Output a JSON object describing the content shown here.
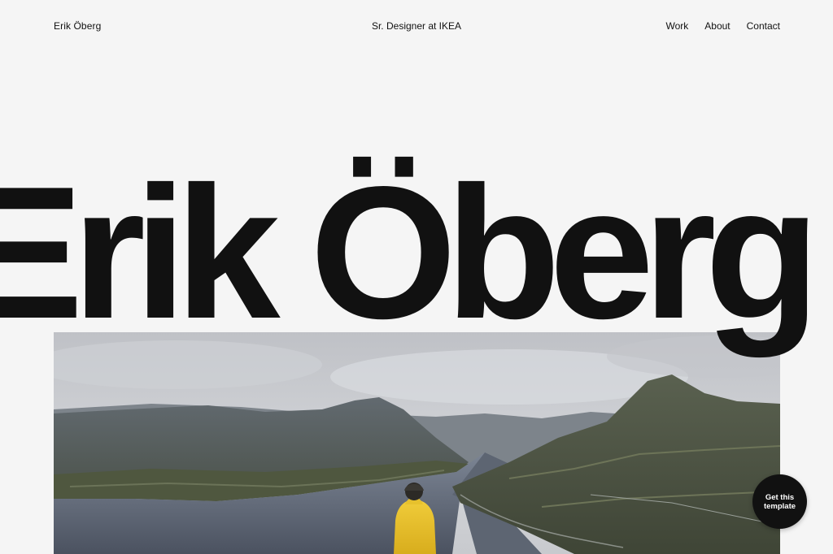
{
  "header": {
    "brand": "Erik Öberg",
    "role": "Sr. Designer at IKEA",
    "nav": [
      {
        "label": "Work"
      },
      {
        "label": "About"
      },
      {
        "label": "Contact"
      }
    ]
  },
  "hero": {
    "title": "Erik Öberg —",
    "image_icon": "fjord-landscape-photo"
  },
  "cta": {
    "label": "Get this template"
  },
  "colors": {
    "background": "#f5f5f5",
    "text": "#111111",
    "cta_background": "#111111",
    "jacket_accent": "#e8c12e"
  }
}
